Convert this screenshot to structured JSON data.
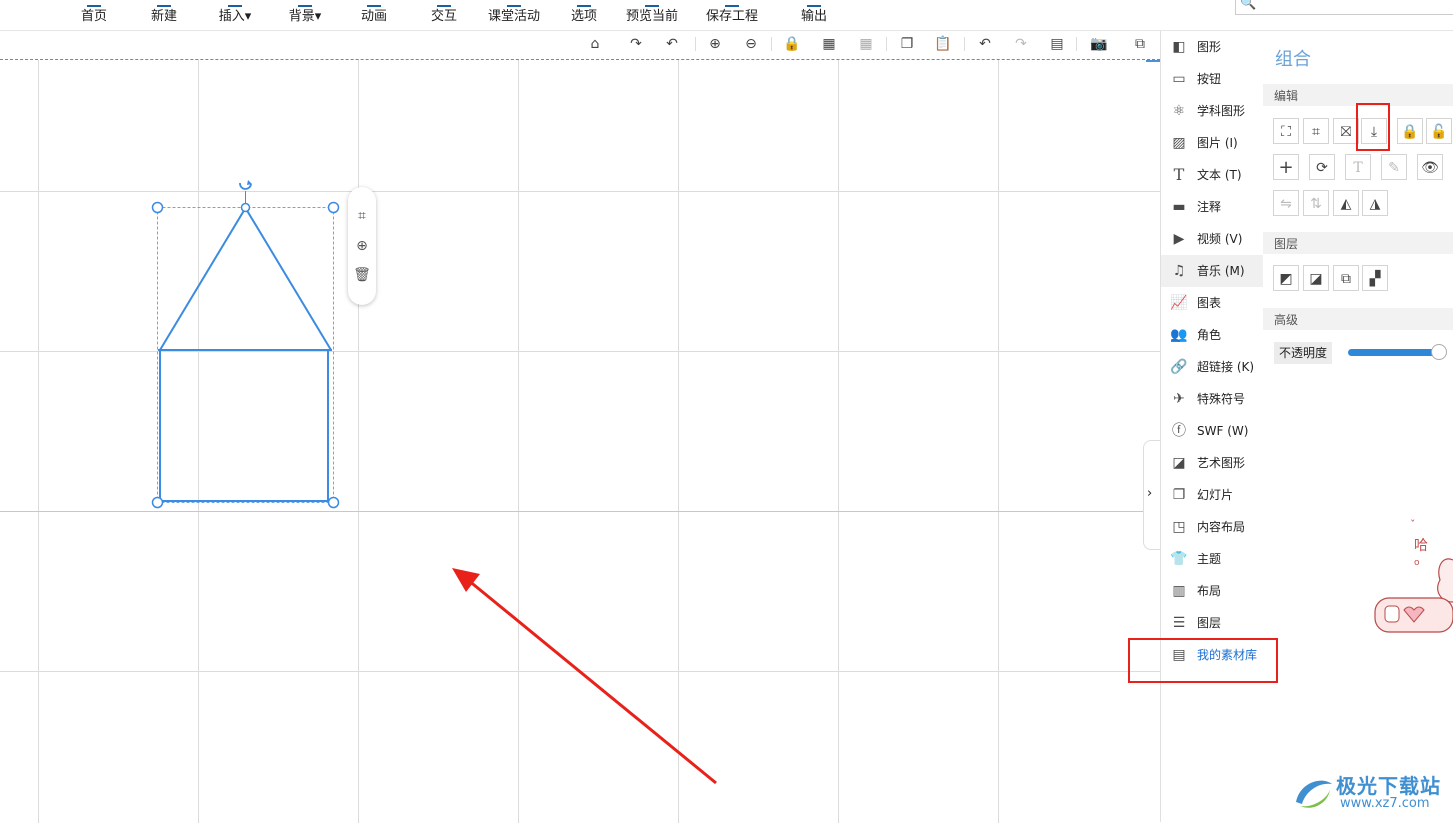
{
  "ribbon": {
    "items": [
      {
        "label": "首页"
      },
      {
        "label": "新建"
      },
      {
        "label": "插入▾"
      },
      {
        "label": "背景▾"
      },
      {
        "label": "动画"
      },
      {
        "label": "交互"
      },
      {
        "label": "课堂活动"
      },
      {
        "label": "选项"
      },
      {
        "label": "预览当前"
      },
      {
        "label": "保存工程"
      },
      {
        "label": "输出"
      }
    ]
  },
  "search": {
    "icon": "search-icon"
  },
  "canvas_toolbar": {
    "icons": [
      "home-icon",
      "redo-shape-icon",
      "undo-shape-icon",
      "zoom-in-icon",
      "zoom-out-icon",
      "lock-icon",
      "grid-icon",
      "grid-settings-icon",
      "copy-icon",
      "paste-icon",
      "undo-icon",
      "redo-icon",
      "properties-icon",
      "screenshot-icon",
      "fullscreen-icon"
    ]
  },
  "float_bar": {
    "icons": [
      "crop-icon",
      "add-circle-icon",
      "delete-icon"
    ]
  },
  "side_menu": {
    "items": [
      {
        "label": "图形",
        "icon": "shape-icon"
      },
      {
        "label": "按钮",
        "icon": "button-icon"
      },
      {
        "label": "学科图形",
        "icon": "science-shape-icon"
      },
      {
        "label": "图片 (I)",
        "icon": "image-icon"
      },
      {
        "label": "文本 (T)",
        "icon": "text-icon"
      },
      {
        "label": "注释",
        "icon": "comment-icon"
      },
      {
        "label": "视频 (V)",
        "icon": "video-icon"
      },
      {
        "label": "音乐 (M)",
        "icon": "music-icon"
      },
      {
        "label": "图表",
        "icon": "chart-icon"
      },
      {
        "label": "角色",
        "icon": "character-icon"
      },
      {
        "label": "超链接 (K)",
        "icon": "link-icon"
      },
      {
        "label": "特殊符号",
        "icon": "special-symbol-icon"
      },
      {
        "label": "SWF (W)",
        "icon": "swf-icon"
      },
      {
        "label": "艺术图形",
        "icon": "art-shape-icon"
      },
      {
        "label": "幻灯片",
        "icon": "slide-icon"
      },
      {
        "label": "内容布局",
        "icon": "content-layout-icon"
      },
      {
        "label": "主题",
        "icon": "theme-icon"
      },
      {
        "label": "布局",
        "icon": "layout-icon"
      },
      {
        "label": "图层",
        "icon": "layers-icon"
      },
      {
        "label": "我的素材库",
        "icon": "my-library-icon"
      }
    ]
  },
  "panel": {
    "title": "组合",
    "sections": {
      "edit": "编辑",
      "layer": "图层",
      "advanced": "高级"
    },
    "opacity_label": "不透明度",
    "opacity_value": 1.0
  },
  "watermark": {
    "title": "极光下载站",
    "url": "www.xz7.com"
  },
  "colors": {
    "accent": "#2f87d8",
    "shape_stroke": "#3b8be0",
    "annotation": "#e8221a"
  }
}
